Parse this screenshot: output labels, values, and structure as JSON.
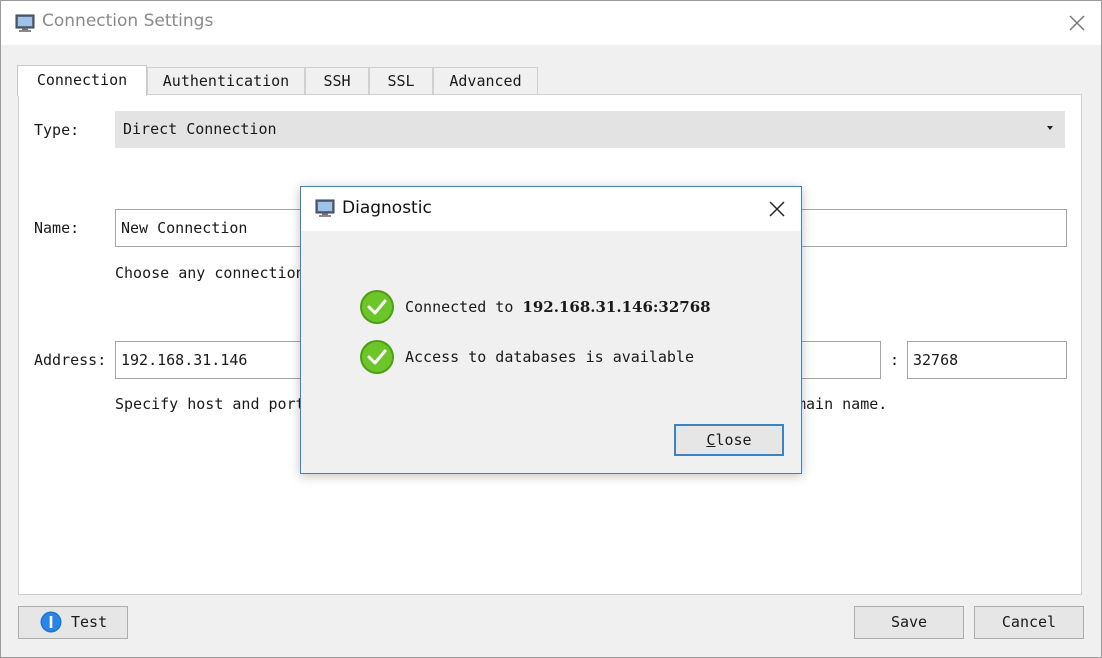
{
  "window": {
    "title": "Connection Settings",
    "icon": "monitor-icon"
  },
  "tabs": [
    {
      "label": "Connection",
      "active": true
    },
    {
      "label": "Authentication",
      "active": false
    },
    {
      "label": "SSH",
      "active": false
    },
    {
      "label": "SSL",
      "active": false
    },
    {
      "label": "Advanced",
      "active": false
    }
  ],
  "form": {
    "type_label": "Type:",
    "type_value": "Direct Connection",
    "name_label": "Name:",
    "name_value": "New Connection",
    "name_hint": "Choose any connection",
    "address_label": "Address:",
    "address_value": "192.168.31.146",
    "port_separator": ":",
    "port_value": "32768",
    "address_hint_left": "Specify host and port",
    "address_hint_right": "main name."
  },
  "footer": {
    "test_label": "Test",
    "save_label": "Save",
    "cancel_label": "Cancel"
  },
  "dialog": {
    "title": "Diagnostic",
    "messages": [
      {
        "prefix": "Connected to ",
        "bold": "192.168.31.146:32768",
        "icon": "check-icon"
      },
      {
        "prefix": "Access to databases is available",
        "bold": "",
        "icon": "check-icon"
      }
    ],
    "close_label_underlined": "C",
    "close_label_rest": "lose"
  },
  "colors": {
    "accent_blue": "#3b84c4",
    "success_green": "#58b41c",
    "info_blue": "#1e73d2"
  }
}
